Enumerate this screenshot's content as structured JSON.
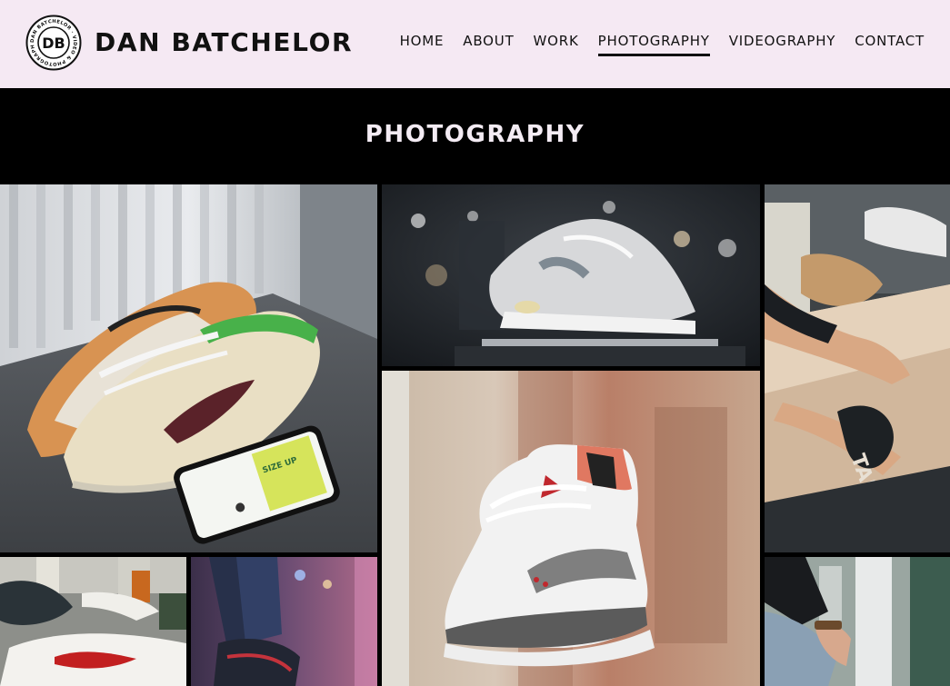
{
  "site": {
    "brand": "DAN BATCHELOR",
    "logo": {
      "monogram": "DB",
      "ring_text": "DAN BATCHELOR · VIDEO & PHOTOGRAPHY ·"
    }
  },
  "nav": {
    "items": [
      {
        "label": "HOME",
        "active": false
      },
      {
        "label": "ABOUT",
        "active": false
      },
      {
        "label": "WORK",
        "active": false
      },
      {
        "label": "PHOTOGRAPHY",
        "active": true
      },
      {
        "label": "VIDEOGRAPHY",
        "active": false
      },
      {
        "label": "CONTACT",
        "active": false
      }
    ]
  },
  "page": {
    "title": "PHOTOGRAPHY"
  },
  "gallery": {
    "photos": [
      {
        "subject": "dunks-on-table"
      },
      {
        "subject": "air-max-display"
      },
      {
        "subject": "shirt-printing"
      },
      {
        "subject": "jordan-3-floating"
      },
      {
        "subject": "bleached-shirt-workshop"
      },
      {
        "subject": "sneakers-street-night"
      },
      {
        "subject": "person-denim-outdoors"
      }
    ],
    "phone_screen_text": "SIZE UP"
  },
  "colors": {
    "header_bg": "#f5e9f3",
    "page_bg": "#000000",
    "banner_text": "#f4ecf4",
    "nav_text": "#111111"
  }
}
